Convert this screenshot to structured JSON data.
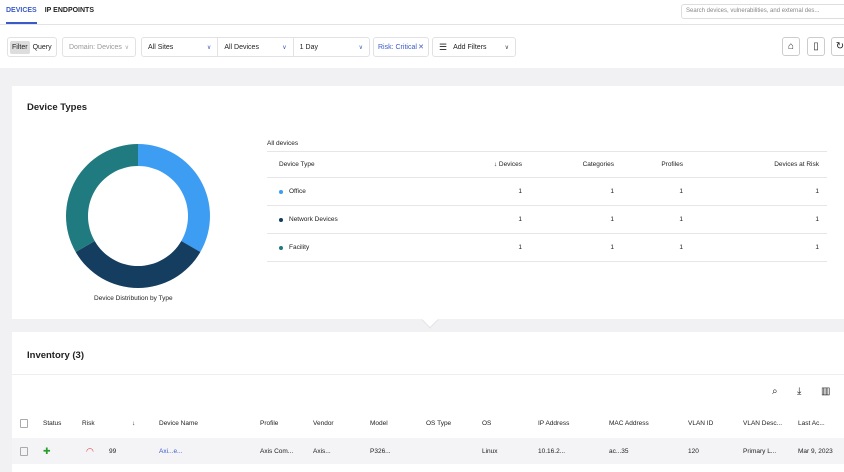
{
  "tabs": [
    {
      "label": "DEVICES",
      "active": true
    },
    {
      "label": "IP ENDPOINTS",
      "active": false
    }
  ],
  "search": {
    "placeholder": "Search devices, vulnerabilities, and external des..."
  },
  "filter_bar": {
    "filter": "Filter",
    "query": "Query",
    "domain": "Domain: Devices",
    "sites": "All Sites",
    "devices": "All Devices",
    "time": "1 Day",
    "risk_chip": "Risk: Critical",
    "add_filters": "Add Filters"
  },
  "device_types": {
    "title": "Device Types",
    "chart_caption": "Device Distribution by Type",
    "table_title": "All devices",
    "columns": [
      "Device Type",
      "Devices",
      "Categories",
      "Profiles",
      "Devices at Risk"
    ],
    "sort_icon": "arrow-down",
    "rows": [
      {
        "type": "Office",
        "color": "#3d9df3",
        "devices": "1",
        "categories": "1",
        "profiles": "1",
        "at_risk": "1"
      },
      {
        "type": "Network Devices",
        "color": "#143d5f",
        "devices": "1",
        "categories": "1",
        "profiles": "1",
        "at_risk": "1"
      },
      {
        "type": "Facility",
        "color": "#207b80",
        "devices": "1",
        "categories": "1",
        "profiles": "1",
        "at_risk": "1"
      }
    ]
  },
  "chart_data": {
    "type": "pie",
    "variant": "donut",
    "categories": [
      "Office",
      "Network Devices",
      "Facility"
    ],
    "values": [
      1,
      1,
      1
    ],
    "colors": [
      "#3d9df3",
      "#143d5f",
      "#207b80"
    ]
  },
  "inventory": {
    "title": "Inventory (3)",
    "columns": [
      "Status",
      "Risk",
      "Device Name",
      "Profile",
      "Vendor",
      "Model",
      "OS Type",
      "OS",
      "IP Address",
      "MAC Address",
      "VLAN ID",
      "VLAN Desc...",
      "Last Ac..."
    ],
    "rows": [
      {
        "risk": "99",
        "device_name": "Axi...e...",
        "profile": "Axis Com...",
        "vendor": "Axis...",
        "model": "P326...",
        "os_type": "",
        "os": "Linux",
        "ip": "10.16.2...",
        "mac": "ac...35",
        "vlan_id": "120",
        "vlan_desc": "Primary L...",
        "last_active": "Mar 9, 2023"
      }
    ]
  }
}
